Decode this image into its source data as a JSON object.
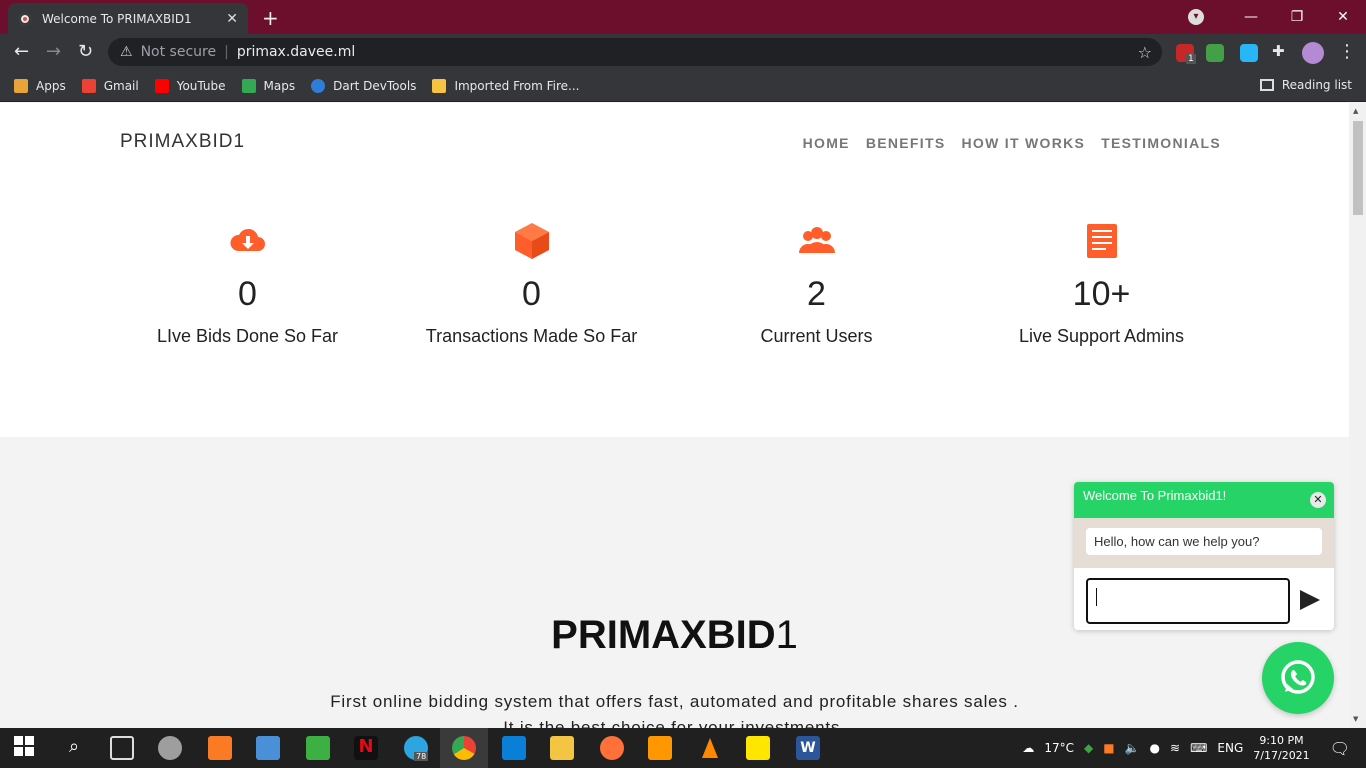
{
  "browser": {
    "tab_title": "Welcome To PRIMAXBID1",
    "security_label": "Not secure",
    "url": "primax.davee.ml",
    "extension_badge": "1",
    "bookmarks": [
      {
        "label": "Apps",
        "color": "#e8a33a"
      },
      {
        "label": "Gmail",
        "color": "#ea4335"
      },
      {
        "label": "YouTube",
        "color": "#ff0000"
      },
      {
        "label": "Maps",
        "color": "#34a853"
      },
      {
        "label": "Dart DevTools",
        "color": "#2e7dd7"
      },
      {
        "label": "Imported From Fire...",
        "color": "#f6c343"
      }
    ],
    "reading_list": "Reading list"
  },
  "site": {
    "brand": "PRIMAXBID1",
    "nav": [
      "HOME",
      "BENEFITS",
      "HOW IT WORKS",
      "TESTIMONIALS"
    ],
    "stats": [
      {
        "icon": "cloud-download-icon",
        "value": "0",
        "label": "LIve Bids Done So Far"
      },
      {
        "icon": "cube-icon",
        "value": "0",
        "label": "Transactions Made So Far"
      },
      {
        "icon": "users-icon",
        "value": "2",
        "label": "Current Users"
      },
      {
        "icon": "document-icon",
        "value": "10+",
        "label": "Live Support Admins"
      }
    ],
    "hero_title_bold": "PRIMAXBID",
    "hero_title_light": "1",
    "hero_line1": "First online bidding system that offers fast, automated and profitable shares sales .",
    "hero_line2": "It is the best choice for your investments."
  },
  "chat": {
    "title": "Welcome To Primaxbid1!",
    "message": "Hello, how can we help you?",
    "input_value": ""
  },
  "taskbar": {
    "weather": "17°C",
    "language": "ENG",
    "time": "9:10 PM",
    "date": "7/17/2021",
    "telegram_badge": "78"
  },
  "colors": {
    "accent_orange": "#ff5e2a",
    "whatsapp_green": "#25d366",
    "tabbar": "#6b0f2c"
  }
}
